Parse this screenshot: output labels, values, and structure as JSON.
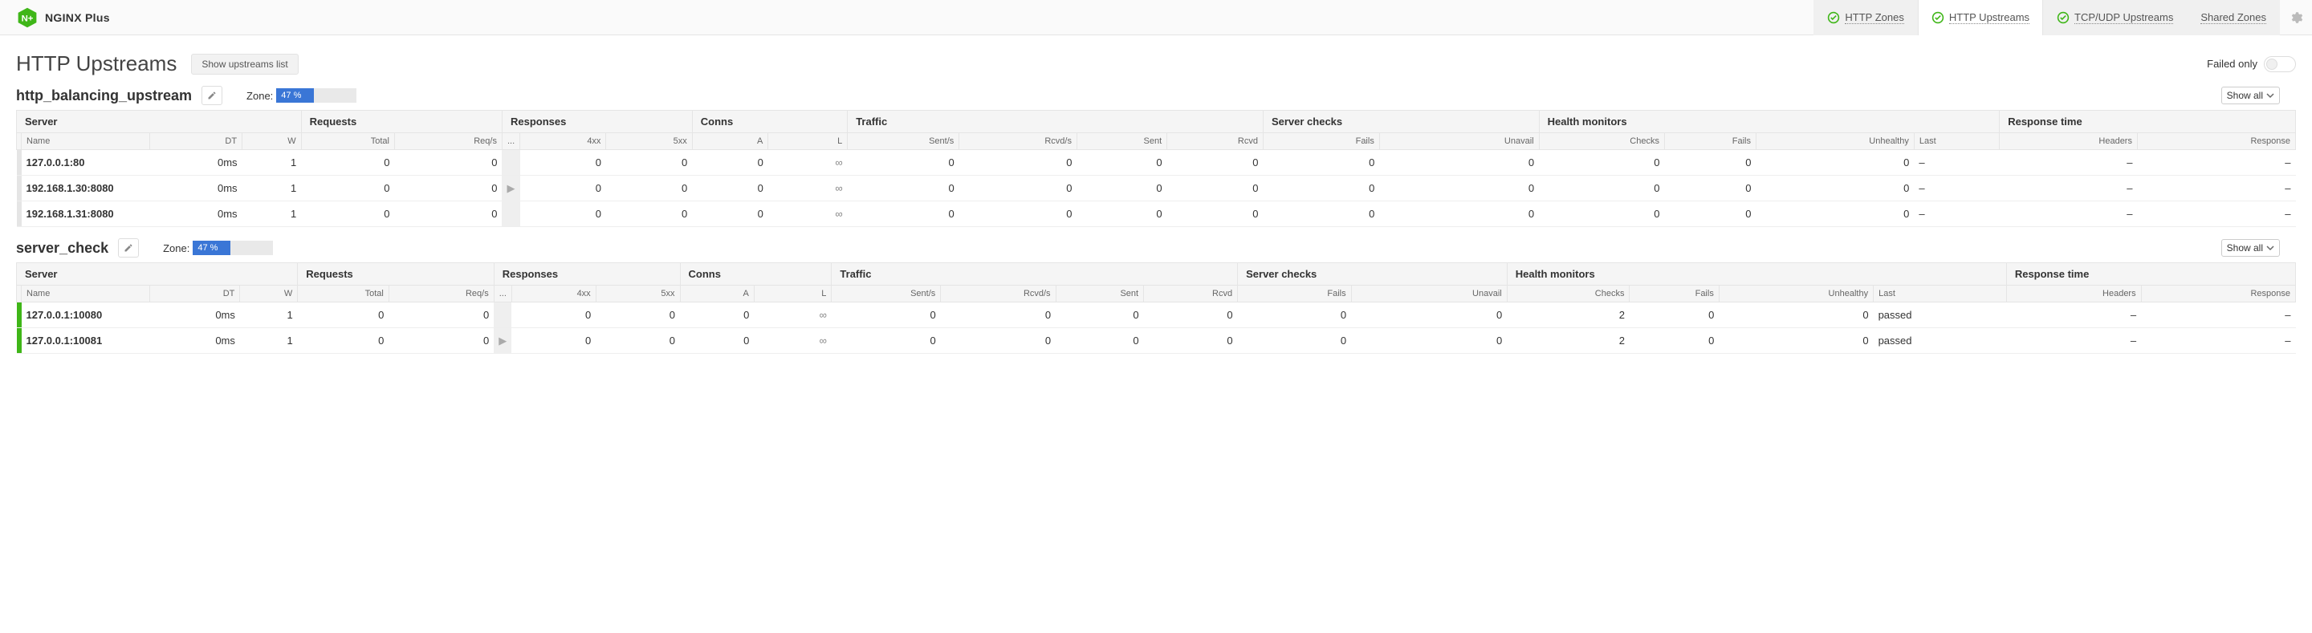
{
  "brand": "NGINX Plus",
  "tabs": {
    "http_zones": "HTTP Zones",
    "http_upstreams": "HTTP Upstreams",
    "tcp_udp": "TCP/UDP Upstreams",
    "shared": "Shared Zones"
  },
  "page": {
    "title": "HTTP Upstreams",
    "show_list": "Show upstreams list",
    "failed_only": "Failed only",
    "show_all": "Show all",
    "zone_label": "Zone:"
  },
  "cols": {
    "server": "Server",
    "requests": "Requests",
    "responses": "Responses",
    "conns": "Conns",
    "traffic": "Traffic",
    "server_checks": "Server checks",
    "health": "Health monitors",
    "resp_time": "Response time",
    "name": "Name",
    "dt": "DT",
    "w": "W",
    "total": "Total",
    "reqs": "Req/s",
    "dots": "...",
    "r4xx": "4xx",
    "r5xx": "5xx",
    "a": "A",
    "l": "L",
    "sents": "Sent/s",
    "rcvds": "Rcvd/s",
    "sent": "Sent",
    "rcvd": "Rcvd",
    "fails": "Fails",
    "unavail": "Unavail",
    "checks": "Checks",
    "unhealthy": "Unhealthy",
    "last": "Last",
    "headers": "Headers",
    "response": "Response"
  },
  "upstreams": [
    {
      "name": "http_balancing_upstream",
      "zone_pct": "47 %",
      "zone_fill": 47,
      "rows": [
        {
          "status": "none",
          "name": "127.0.0.1:80",
          "dt": "0ms",
          "w": "1",
          "total": "0",
          "reqs": "0",
          "r4xx": "0",
          "r5xx": "0",
          "a": "0",
          "l": "∞",
          "sents": "0",
          "rcvds": "0",
          "sent": "0",
          "rcvd": "0",
          "fails": "0",
          "unavail": "0",
          "checks": "0",
          "hfails": "0",
          "unhealthy": "0",
          "last": "–",
          "headers": "–",
          "response": "–"
        },
        {
          "status": "none",
          "name": "192.168.1.30:8080",
          "dt": "0ms",
          "w": "1",
          "total": "0",
          "reqs": "0",
          "r4xx": "0",
          "r5xx": "0",
          "a": "0",
          "l": "∞",
          "sents": "0",
          "rcvds": "0",
          "sent": "0",
          "rcvd": "0",
          "fails": "0",
          "unavail": "0",
          "checks": "0",
          "hfails": "0",
          "unhealthy": "0",
          "last": "–",
          "headers": "–",
          "response": "–"
        },
        {
          "status": "none",
          "name": "192.168.1.31:8080",
          "dt": "0ms",
          "w": "1",
          "total": "0",
          "reqs": "0",
          "r4xx": "0",
          "r5xx": "0",
          "a": "0",
          "l": "∞",
          "sents": "0",
          "rcvds": "0",
          "sent": "0",
          "rcvd": "0",
          "fails": "0",
          "unavail": "0",
          "checks": "0",
          "hfails": "0",
          "unhealthy": "0",
          "last": "–",
          "headers": "–",
          "response": "–"
        }
      ]
    },
    {
      "name": "server_check",
      "zone_pct": "47 %",
      "zone_fill": 47,
      "rows": [
        {
          "status": "ok",
          "name": "127.0.0.1:10080",
          "dt": "0ms",
          "w": "1",
          "total": "0",
          "reqs": "0",
          "r4xx": "0",
          "r5xx": "0",
          "a": "0",
          "l": "∞",
          "sents": "0",
          "rcvds": "0",
          "sent": "0",
          "rcvd": "0",
          "fails": "0",
          "unavail": "0",
          "checks": "2",
          "hfails": "0",
          "unhealthy": "0",
          "last": "passed",
          "headers": "–",
          "response": "–"
        },
        {
          "status": "ok",
          "name": "127.0.0.1:10081",
          "dt": "0ms",
          "w": "1",
          "total": "0",
          "reqs": "0",
          "r4xx": "0",
          "r5xx": "0",
          "a": "0",
          "l": "∞",
          "sents": "0",
          "rcvds": "0",
          "sent": "0",
          "rcvd": "0",
          "fails": "0",
          "unavail": "0",
          "checks": "2",
          "hfails": "0",
          "unhealthy": "0",
          "last": "passed",
          "headers": "–",
          "response": "–"
        }
      ]
    }
  ]
}
